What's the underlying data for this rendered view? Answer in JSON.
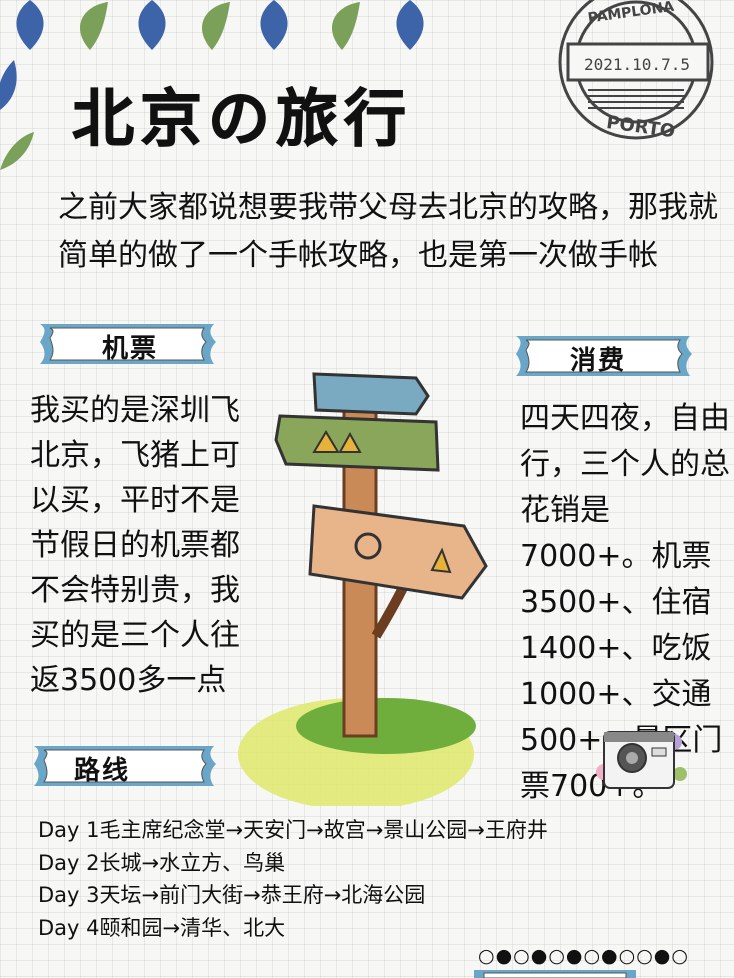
{
  "title": "北京の旅行",
  "intro": "之前大家都说想要我带父母去北京的攻略，那我就简单的做了一个手帐攻略，也是第一次做手帐",
  "stamp": {
    "date": "2021.10.7.5",
    "city": "PORTO",
    "top_text": "PAMPLONA"
  },
  "sections": {
    "tickets": {
      "label": "机票",
      "text": "我买的是深圳飞北京，飞猪上可以买，平时不是节假日的机票都不会特别贵，我买的是三个人往返3500多一点"
    },
    "costs": {
      "label": "消费",
      "text": "四天四夜，自由行，三个人的总花销是7000+。机票3500+、住宿1400+、吃饭1000+、交通500+、景区门票700+。"
    },
    "route": {
      "label": "路线",
      "days": [
        "Day 1毛主席纪念堂→天安门→故宫→景山公园→王府井",
        "Day 2长城→水立方、鸟巢",
        "Day 3天坛→前门大街→恭王府→北海公园",
        "Day 4颐和园→清华、北大"
      ]
    }
  },
  "dots": "○●○●○●○●○○●○",
  "colors": {
    "leaf_blue": "#3d63a8",
    "leaf_green": "#7aa05a",
    "ribbon_blue": "#6aa6c7",
    "wood": "#d99a6a"
  },
  "icons": [
    "leaf-icon",
    "postmark-stamp",
    "signpost-illustration",
    "camera-icon"
  ]
}
